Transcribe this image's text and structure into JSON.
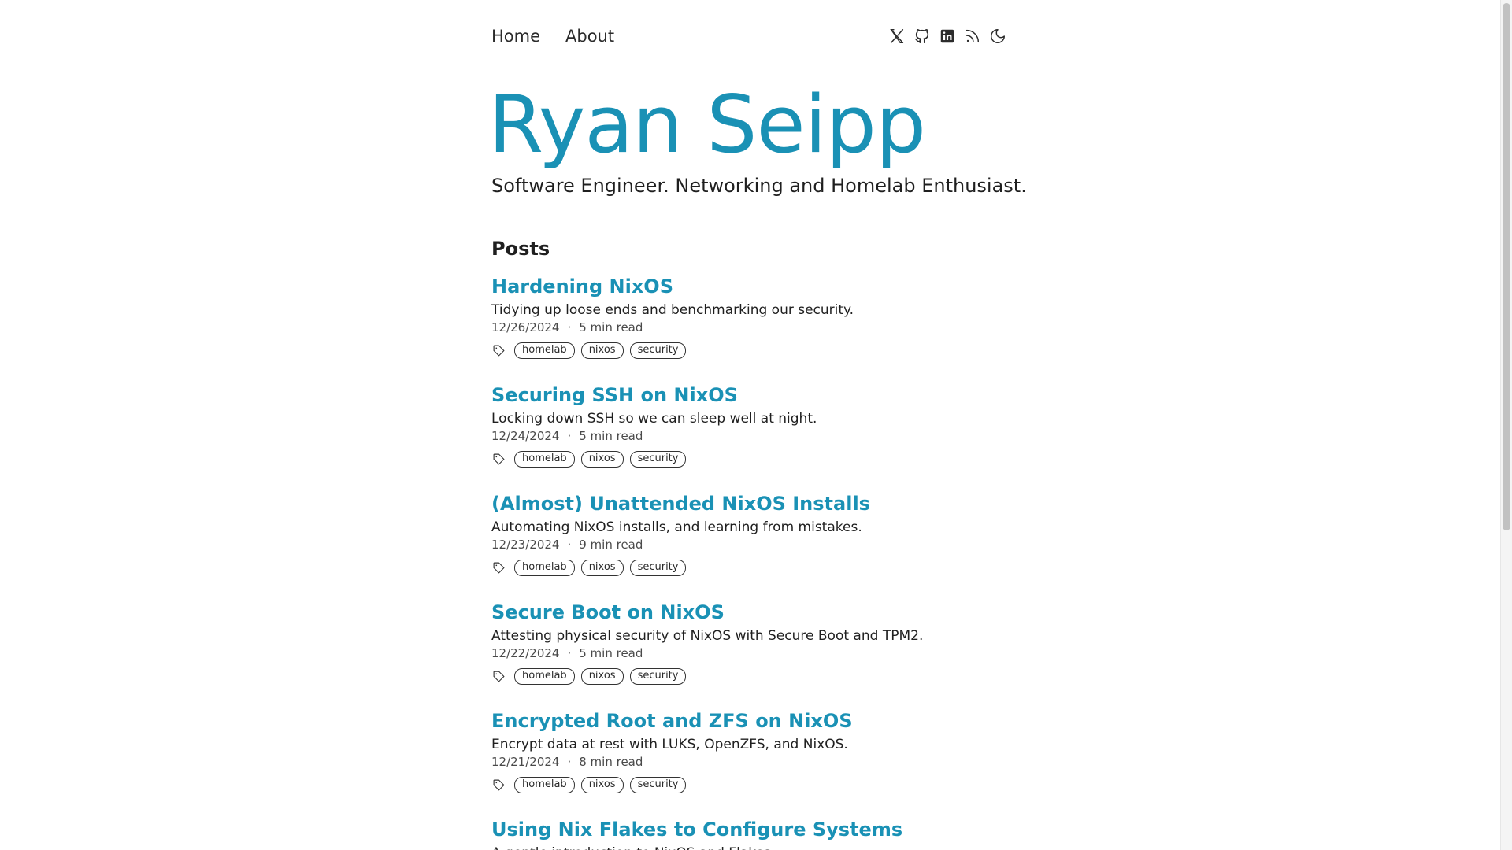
{
  "nav": {
    "links": [
      "Home",
      "About"
    ],
    "icons": [
      "x-icon",
      "github-icon",
      "linkedin-icon",
      "rss-icon",
      "moon-icon"
    ]
  },
  "hero": {
    "title": "Ryan Seipp",
    "subtitle": "Software Engineer. Networking and Homelab Enthusiast."
  },
  "posts_heading": "Posts",
  "posts": [
    {
      "title": "Hardening NixOS",
      "description": "Tidying up loose ends and benchmarking our security.",
      "date": "12/26/2024",
      "separator": "·",
      "read_time": "5 min read",
      "tags": [
        "homelab",
        "nixos",
        "security"
      ]
    },
    {
      "title": "Securing SSH on NixOS",
      "description": "Locking down SSH so we can sleep well at night.",
      "date": "12/24/2024",
      "separator": "·",
      "read_time": "5 min read",
      "tags": [
        "homelab",
        "nixos",
        "security"
      ]
    },
    {
      "title": "(Almost) Unattended NixOS Installs",
      "description": "Automating NixOS installs, and learning from mistakes.",
      "date": "12/23/2024",
      "separator": "·",
      "read_time": "9 min read",
      "tags": [
        "homelab",
        "nixos",
        "security"
      ]
    },
    {
      "title": "Secure Boot on NixOS",
      "description": "Attesting physical security of NixOS with Secure Boot and TPM2.",
      "date": "12/22/2024",
      "separator": "·",
      "read_time": "5 min read",
      "tags": [
        "homelab",
        "nixos",
        "security"
      ]
    },
    {
      "title": "Encrypted Root and ZFS on NixOS",
      "description": "Encrypt data at rest with LUKS, OpenZFS, and NixOS.",
      "date": "12/21/2024",
      "separator": "·",
      "read_time": "8 min read",
      "tags": [
        "homelab",
        "nixos",
        "security"
      ]
    },
    {
      "title": "Using Nix Flakes to Configure Systems",
      "description": "A gentle introduction to NixOS and Flakes.",
      "date": "",
      "separator": "",
      "read_time": "",
      "tags": []
    }
  ],
  "colors": {
    "accent": "#1a91b5",
    "text": "#1f1f1f",
    "muted": "#4a4a4a"
  }
}
